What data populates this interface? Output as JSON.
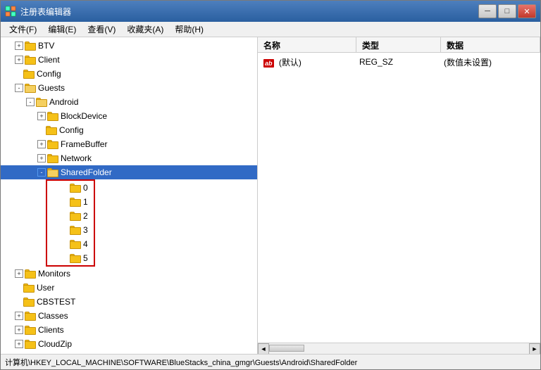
{
  "window": {
    "title": "注册表编辑器",
    "title_icon": "regedit"
  },
  "titlebar_controls": {
    "minimize": "─",
    "maximize": "□",
    "close": "✕"
  },
  "menu": {
    "items": [
      {
        "label": "文件(F)"
      },
      {
        "label": "编辑(E)"
      },
      {
        "label": "查看(V)"
      },
      {
        "label": "收藏夹(A)"
      },
      {
        "label": "帮助(H)"
      }
    ]
  },
  "tree": {
    "items": [
      {
        "id": "btv",
        "label": "BTV",
        "indent": 1,
        "expanded": false,
        "has_children": true
      },
      {
        "id": "client",
        "label": "Client",
        "indent": 1,
        "expanded": false,
        "has_children": true
      },
      {
        "id": "config",
        "label": "Config",
        "indent": 1,
        "expanded": false,
        "has_children": false
      },
      {
        "id": "guests",
        "label": "Guests",
        "indent": 1,
        "expanded": true,
        "has_children": true
      },
      {
        "id": "android",
        "label": "Android",
        "indent": 2,
        "expanded": true,
        "has_children": true
      },
      {
        "id": "blockdevice",
        "label": "BlockDevice",
        "indent": 3,
        "expanded": false,
        "has_children": true
      },
      {
        "id": "config2",
        "label": "Config",
        "indent": 3,
        "expanded": false,
        "has_children": false
      },
      {
        "id": "framebuffer",
        "label": "FrameBuffer",
        "indent": 3,
        "expanded": false,
        "has_children": true
      },
      {
        "id": "network",
        "label": "Network",
        "indent": 3,
        "expanded": false,
        "has_children": true
      },
      {
        "id": "sharedfolder",
        "label": "SharedFolder",
        "indent": 3,
        "expanded": true,
        "has_children": true,
        "selected": true
      },
      {
        "id": "sf0",
        "label": "0",
        "indent": 4,
        "expanded": false,
        "has_children": false,
        "in_red_box": true
      },
      {
        "id": "sf1",
        "label": "1",
        "indent": 4,
        "expanded": false,
        "has_children": false,
        "in_red_box": true
      },
      {
        "id": "sf2",
        "label": "2",
        "indent": 4,
        "expanded": false,
        "has_children": false,
        "in_red_box": true
      },
      {
        "id": "sf3",
        "label": "3",
        "indent": 4,
        "expanded": false,
        "has_children": false,
        "in_red_box": true
      },
      {
        "id": "sf4",
        "label": "4",
        "indent": 4,
        "expanded": false,
        "has_children": false,
        "in_red_box": true
      },
      {
        "id": "sf5",
        "label": "5",
        "indent": 4,
        "expanded": false,
        "has_children": false,
        "in_red_box": true
      },
      {
        "id": "monitors",
        "label": "Monitors",
        "indent": 1,
        "expanded": false,
        "has_children": true
      },
      {
        "id": "user",
        "label": "User",
        "indent": 1,
        "expanded": false,
        "has_children": false
      },
      {
        "id": "cbstest",
        "label": "CBSTEST",
        "indent": 1,
        "expanded": false,
        "has_children": false
      },
      {
        "id": "classes",
        "label": "Classes",
        "indent": 1,
        "expanded": false,
        "has_children": true
      },
      {
        "id": "clients",
        "label": "Clients",
        "indent": 1,
        "expanded": false,
        "has_children": true
      },
      {
        "id": "cloudzip",
        "label": "CloudZip",
        "indent": 1,
        "expanded": false,
        "has_children": true
      }
    ]
  },
  "right_pane": {
    "columns": [
      "名称",
      "类型",
      "数据"
    ],
    "rows": [
      {
        "name": "(默认)",
        "name_prefix": "ab",
        "type": "REG_SZ",
        "data": "(数值未设置)"
      }
    ]
  },
  "status_bar": {
    "text": "计算机\\HKEY_LOCAL_MACHINE\\SOFTWARE\\BlueStacks_china_gmgr\\Guests\\Android\\SharedFolder"
  }
}
